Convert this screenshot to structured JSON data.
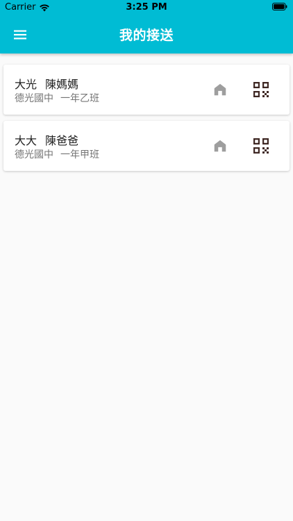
{
  "status_bar": {
    "carrier": "Carrier",
    "time": "3:25 PM",
    "icons": [
      "wifi-icon",
      "battery-icon"
    ]
  },
  "app_bar": {
    "menu_icon": "menu-icon",
    "title": "我的接送",
    "background_color": "#00bcd4",
    "title_color": "#ffffff"
  },
  "pickups": [
    {
      "child": "大光",
      "guardian": "陳媽媽",
      "school": "德光國中",
      "class": "一年乙班",
      "actions": [
        "home-icon",
        "qr-code-icon"
      ]
    },
    {
      "child": "大大",
      "guardian": "陳爸爸",
      "school": "德光國中",
      "class": "一年甲班",
      "actions": [
        "home-icon",
        "qr-code-icon"
      ]
    }
  ],
  "colors": {
    "home_icon": "#9e9e9e",
    "qr_icon": "#3e2723",
    "background": "#fafafa"
  }
}
